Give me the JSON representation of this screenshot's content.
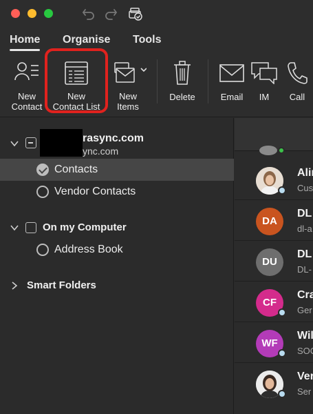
{
  "window": {
    "controls": [
      "close",
      "minimize",
      "zoom"
    ],
    "toolbar_icons": [
      "undo-icon",
      "redo-icon",
      "sync-status-icon"
    ]
  },
  "tabs": [
    {
      "label": "Home",
      "active": true
    },
    {
      "label": "Organise",
      "active": false
    },
    {
      "label": "Tools",
      "active": false
    }
  ],
  "ribbon": {
    "new_contact": {
      "line1": "New",
      "line2": "Contact"
    },
    "new_contact_list": {
      "line1": "New",
      "line2": "Contact List"
    },
    "new_items": {
      "line1": "New",
      "line2": "Items"
    },
    "delete": {
      "label": "Delete"
    },
    "email": {
      "label": "Email"
    },
    "im": {
      "label": "IM"
    },
    "call": {
      "label": "Call"
    },
    "highlight_color": "#e0221e"
  },
  "sidebar": {
    "account": {
      "name": "rasync.com",
      "sub": "ync.com"
    },
    "items": [
      {
        "label": "Contacts",
        "selected": true
      },
      {
        "label": "Vendor Contacts",
        "selected": false
      }
    ],
    "on_my_computer": {
      "label": "On my Computer",
      "items": [
        {
          "label": "Address Book"
        }
      ]
    },
    "smart_folders": {
      "label": "Smart Folders"
    }
  },
  "contacts": [
    {
      "name": "Alin",
      "sub": "Cus",
      "initials": "",
      "color": "#c9b9a9",
      "photo": true
    },
    {
      "name": "DL",
      "sub": "dl-a",
      "initials": "DA",
      "color": "#c9541f",
      "photo": false
    },
    {
      "name": "DL",
      "sub": "DL-",
      "initials": "DU",
      "color": "#6e6e6e",
      "photo": false
    },
    {
      "name": "Cra",
      "sub": "Ger",
      "initials": "CF",
      "color": "#d42b8c",
      "photo": false
    },
    {
      "name": "Wil",
      "sub": "SOC",
      "initials": "WF",
      "color": "#b33bb8",
      "photo": false
    },
    {
      "name": "Ver",
      "sub": "Ser",
      "initials": "",
      "color": "#e4e4e4",
      "photo": true
    }
  ]
}
